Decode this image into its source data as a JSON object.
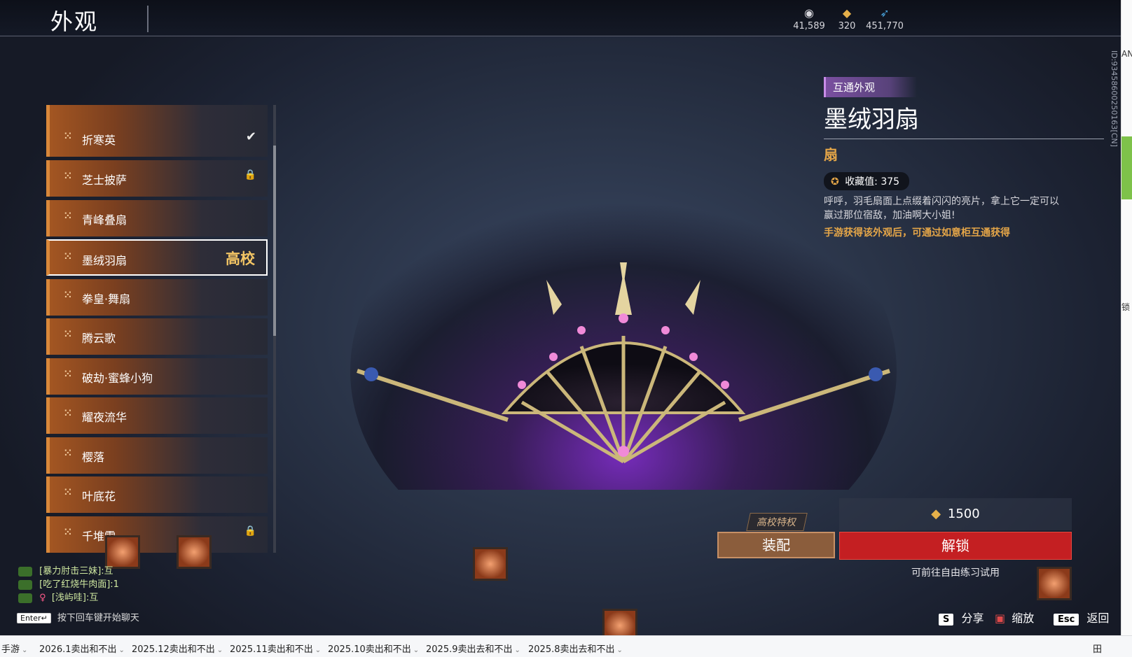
{
  "header": {
    "title": "外观"
  },
  "currencies": [
    {
      "icon": "coin-stack-icon",
      "value": "41,589"
    },
    {
      "icon": "gold-ingot-icon",
      "value": "320"
    },
    {
      "icon": "feather-icon",
      "value": "451,770"
    }
  ],
  "list": {
    "items": [
      {
        "name": "折寒英",
        "state": "✔",
        "state_icon": "check-icon"
      },
      {
        "name": "芝士披萨",
        "state": "🔒",
        "state_icon": "lock-icon"
      },
      {
        "name": "青峰叠扇",
        "state": "",
        "state_icon": ""
      },
      {
        "name": "墨绒羽扇",
        "state": "高校",
        "state_icon": "school-badge",
        "selected": true
      },
      {
        "name": "拳皇·舞扇",
        "state": "",
        "state_icon": ""
      },
      {
        "name": "腾云歌",
        "state": "",
        "state_icon": ""
      },
      {
        "name": "破劫·蜜蜂小狗",
        "state": "",
        "state_icon": ""
      },
      {
        "name": "耀夜流华",
        "state": "",
        "state_icon": ""
      },
      {
        "name": "樱落",
        "state": "",
        "state_icon": ""
      },
      {
        "name": "叶底花",
        "state": "",
        "state_icon": ""
      },
      {
        "name": "千堆雪",
        "state": "🔒",
        "state_icon": "lock-icon"
      }
    ]
  },
  "detail": {
    "tag": "互通外观",
    "name": "墨绒羽扇",
    "type": "扇",
    "collection_label": "收藏值: 375",
    "description": "呼呼，羽毛扇面上点缀着闪闪的亮片，拿上它一定可以赢过那位宿敌，加油啊大小姐!",
    "note": "手游获得该外观后，可通过如意柜互通获得",
    "id_text": "ID:93458600250163[CN]"
  },
  "purchase": {
    "privilege": "高校特权",
    "equip_label": "装配",
    "price": "1500",
    "unlock_label": "解锁",
    "trial_hint": "可前往自由练习试用"
  },
  "chat": {
    "lines": [
      {
        "text": "[暴力肘击三妹]:互",
        "female": false
      },
      {
        "text": "[吃了红烧牛肉面]:1",
        "female": false
      },
      {
        "text": "[浅屿哇]:互",
        "female": true
      }
    ],
    "enter_key": "Enter↵",
    "enter_hint": "按下回车键开始聊天"
  },
  "hotkeys": [
    {
      "key": "S",
      "label": "分享"
    },
    {
      "key": "",
      "label": "缩放"
    },
    {
      "key": "Esc",
      "label": "返回"
    }
  ],
  "taskbar": {
    "tabs": [
      "手游",
      "2026.1卖出和不出",
      "2025.12卖出和不出",
      "2025.11卖出和不出",
      "2025.10卖出和不出",
      "2025.9卖出去和不出",
      "2025.8卖出去和不出"
    ],
    "grid_icon": "田"
  },
  "right_strip": {
    "label_top": "AN",
    "label_mid": "锁"
  },
  "colors": {
    "accent_orange": "#d9883a",
    "unlock_red": "#c41f22",
    "gold": "#e5a648",
    "tag_purple": "#7a4fa0"
  }
}
